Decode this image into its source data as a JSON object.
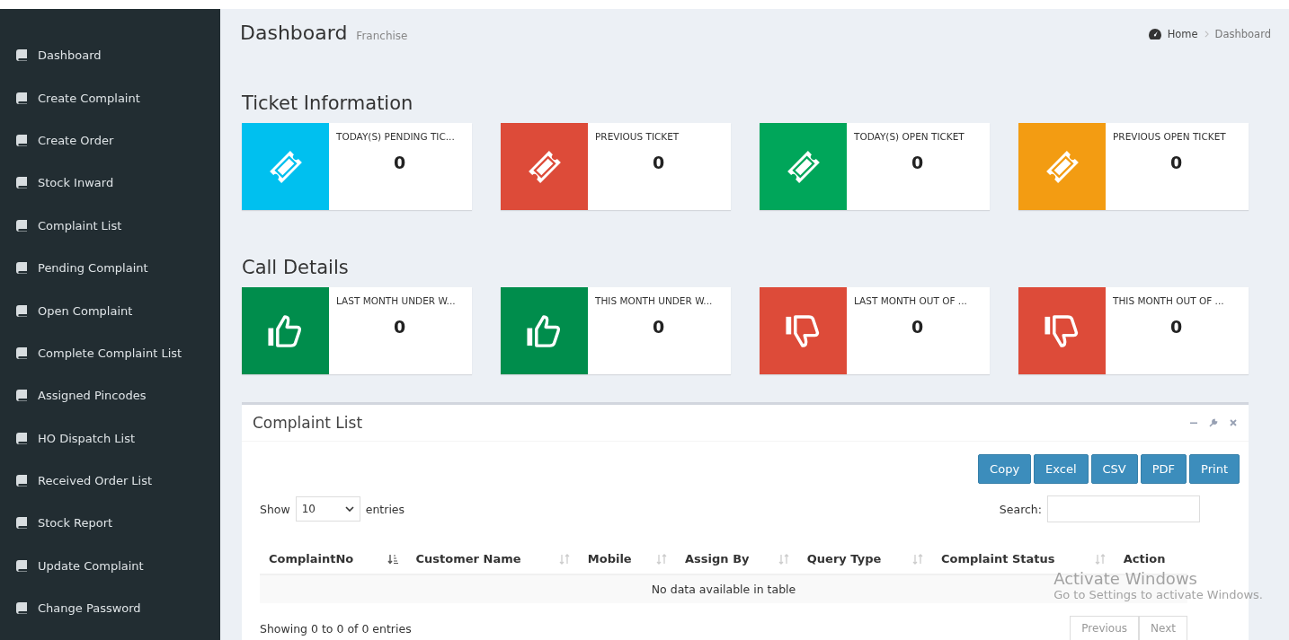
{
  "sidebar": {
    "items": [
      {
        "label": "Dashboard"
      },
      {
        "label": "Create Complaint"
      },
      {
        "label": "Create Order"
      },
      {
        "label": "Stock Inward"
      },
      {
        "label": "Complaint List"
      },
      {
        "label": "Pending Complaint"
      },
      {
        "label": "Open Complaint"
      },
      {
        "label": "Complete Complaint List"
      },
      {
        "label": "Assigned Pincodes"
      },
      {
        "label": "HO Dispatch List"
      },
      {
        "label": "Received Order List"
      },
      {
        "label": "Stock Report"
      },
      {
        "label": "Update Complaint"
      },
      {
        "label": "Change Password"
      }
    ]
  },
  "header": {
    "title": "Dashboard",
    "subtitle": "Franchise",
    "breadcrumb": [
      "Home",
      "Dashboard"
    ]
  },
  "sections": [
    {
      "title": "Ticket Information",
      "cards": [
        {
          "kind": "ticket",
          "color": "#00c0ef",
          "label": "TODAY(S) PENDING TIC...",
          "value": "0"
        },
        {
          "kind": "ticket",
          "color": "#dd4b39",
          "label": "PREVIOUS TICKET",
          "value": "0"
        },
        {
          "kind": "ticket",
          "color": "#00a65a",
          "label": "TODAY(S) OPEN TICKET",
          "value": "0"
        },
        {
          "kind": "ticket",
          "color": "#f39c12",
          "label": "PREVIOUS OPEN TICKET",
          "value": "0"
        }
      ]
    },
    {
      "title": "Call Details",
      "cards": [
        {
          "kind": "thumbs-up",
          "color": "#008d4c",
          "label": "LAST MONTH UNDER W...",
          "value": "0"
        },
        {
          "kind": "thumbs-up",
          "color": "#008d4c",
          "label": "THIS MONTH UNDER W...",
          "value": "0"
        },
        {
          "kind": "thumbs-down",
          "color": "#dd4b39",
          "label": "LAST MONTH OUT OF ...",
          "value": "0"
        },
        {
          "kind": "thumbs-down",
          "color": "#dd4b39",
          "label": "THIS MONTH OUT OF ...",
          "value": "0"
        }
      ]
    }
  ],
  "complaint_box": {
    "title": "Complaint List",
    "export_buttons": [
      "Copy",
      "Excel",
      "CSV",
      "PDF",
      "Print"
    ],
    "show_label": "Show",
    "page_size": "10",
    "entries_label": "entries",
    "search_label": "Search:",
    "columns": [
      {
        "label": "ComplaintNo",
        "kind": "sorted"
      },
      {
        "label": "Customer Name",
        "kind": "sortable"
      },
      {
        "label": "Mobile",
        "kind": "sortable"
      },
      {
        "label": "Assign By",
        "kind": "sortable"
      },
      {
        "label": "Query Type",
        "kind": "sortable"
      },
      {
        "label": "Complaint Status",
        "kind": "sortable"
      },
      {
        "label": "Action",
        "kind": "plain"
      }
    ],
    "empty_message": "No data available in table",
    "info": "Showing 0 to 0 of 0 entries",
    "pager": [
      "Previous",
      "Next"
    ]
  },
  "os_notice": {
    "title": "Activate Windows",
    "subtitle": "Go to Settings to activate Windows."
  }
}
